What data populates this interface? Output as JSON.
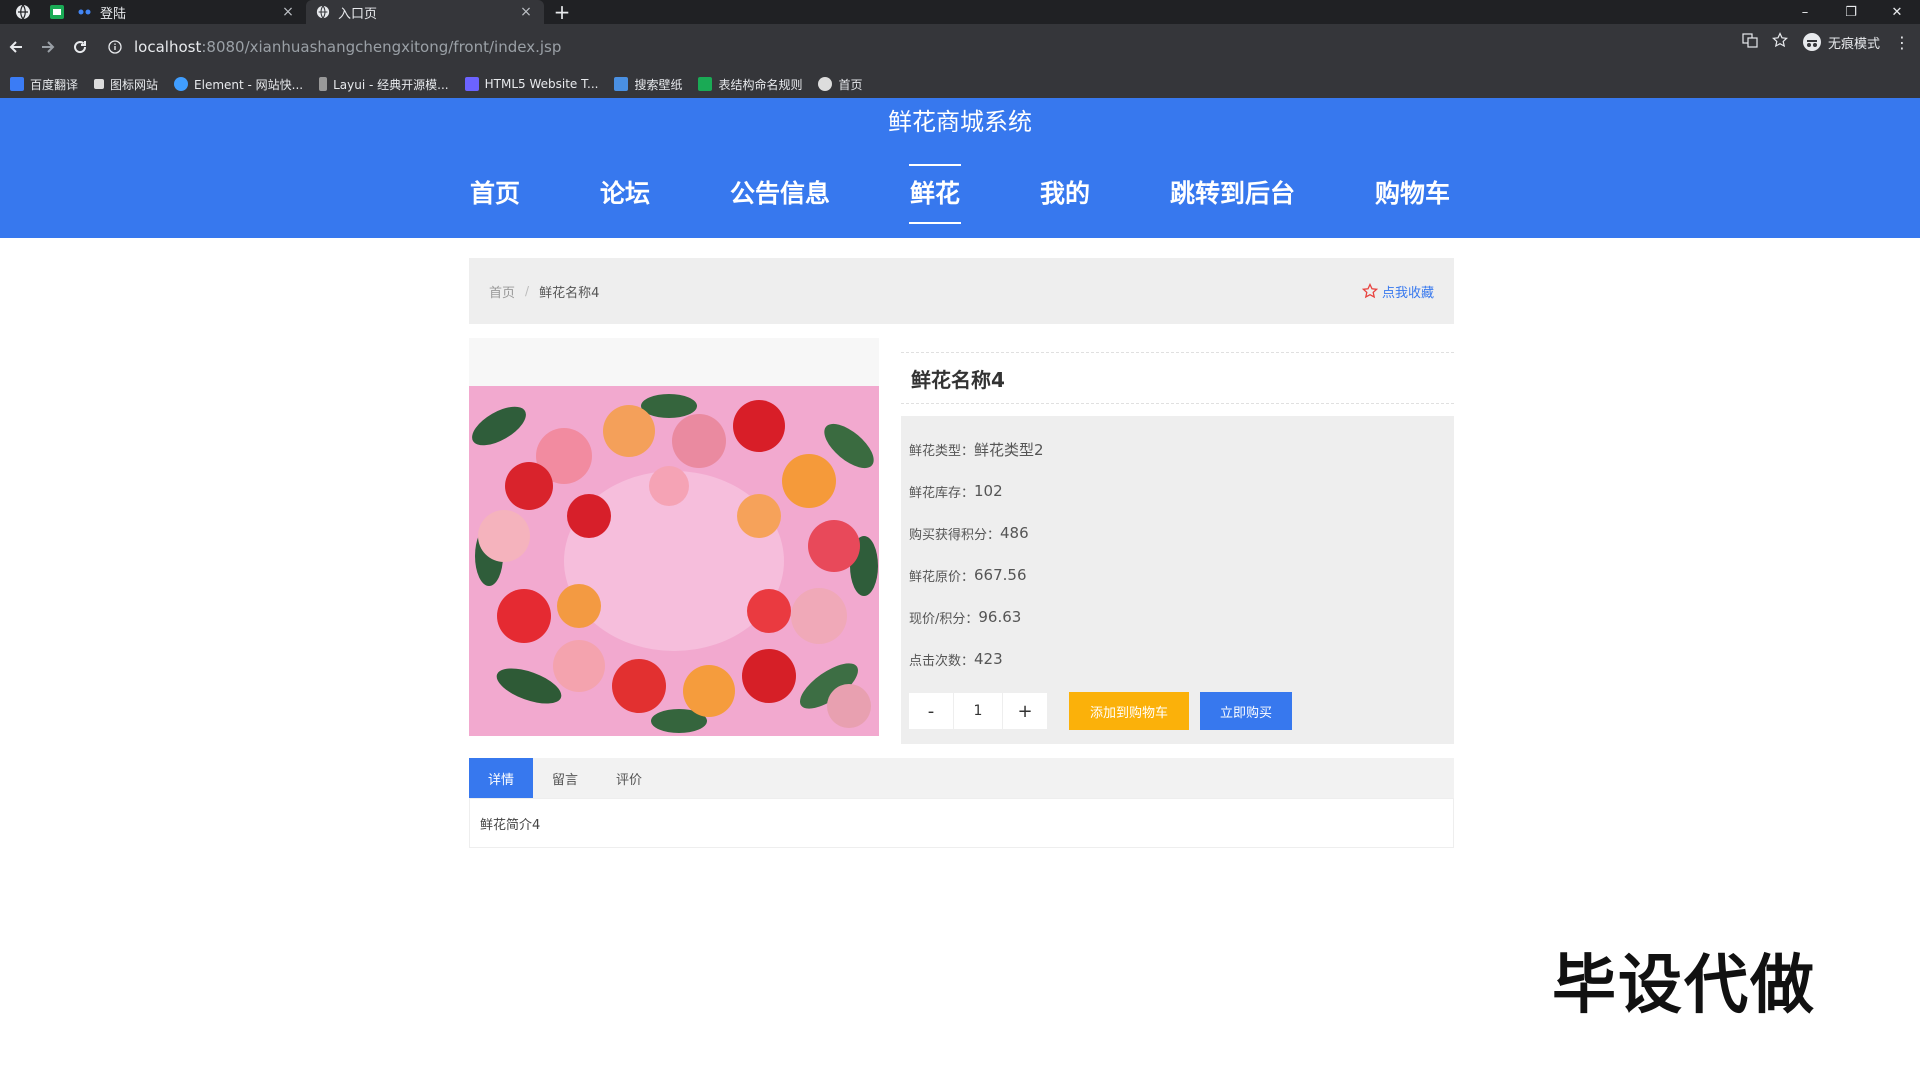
{
  "browser": {
    "tabs": [
      {
        "title": "登陆",
        "close": "×"
      },
      {
        "title": "入口页",
        "close": "×"
      }
    ],
    "new_tab": "+",
    "window_controls": {
      "minimize": "–",
      "restore": "❐",
      "close": "✕"
    },
    "url_host": "localhost",
    "url_path": ":8080/xianhuashangchengxitong/front/index.jsp",
    "incognito_label": "无痕模式",
    "bookmarks": [
      {
        "label": "百度翻译",
        "color": "#3b7cf5"
      },
      {
        "label": "图标网站",
        "color": "#dddddd"
      },
      {
        "label": "Element - 网站快...",
        "color": "#409eff"
      },
      {
        "label": "Layui - 经典开源模...",
        "color": "#999999"
      },
      {
        "label": "HTML5 Website T...",
        "color": "#6c63ff"
      },
      {
        "label": "搜索壁纸",
        "color": "#4a90e2"
      },
      {
        "label": "表结构命名规则",
        "color": "#1aaa55"
      },
      {
        "label": "首页",
        "color": "#dddddd"
      }
    ]
  },
  "site": {
    "title": "鲜花商城系统",
    "nav": [
      {
        "label": "首页"
      },
      {
        "label": "论坛"
      },
      {
        "label": "公告信息"
      },
      {
        "label": "鲜花"
      },
      {
        "label": "我的"
      },
      {
        "label": "跳转到后台"
      },
      {
        "label": "购物车"
      }
    ],
    "active_nav_index": 3,
    "accent": "#3778ee"
  },
  "breadcrumb": {
    "home": "首页",
    "separator": "/",
    "current": "鲜花名称4",
    "favorite_label": "点我收藏"
  },
  "product": {
    "name": "鲜花名称4",
    "fields": [
      {
        "label": "鲜花类型：",
        "value": "鲜花类型2"
      },
      {
        "label": "鲜花库存：",
        "value": "102"
      },
      {
        "label": "购买获得积分：",
        "value": "486"
      },
      {
        "label": "鲜花原价：",
        "value": "667.56"
      },
      {
        "label": "现价/积分：",
        "value": "96.63"
      },
      {
        "label": "点击次数：",
        "value": "423"
      }
    ],
    "qty_minus": "-",
    "quantity": "1",
    "qty_plus": "+",
    "add_to_cart": "添加到购物车",
    "buy_now": "立即购买",
    "cart_color": "#fbb10a"
  },
  "detail_tabs": {
    "tabs": [
      "详情",
      "留言",
      "评价"
    ],
    "active": 0,
    "content": "鲜花简介4"
  },
  "watermark": "毕设代做"
}
